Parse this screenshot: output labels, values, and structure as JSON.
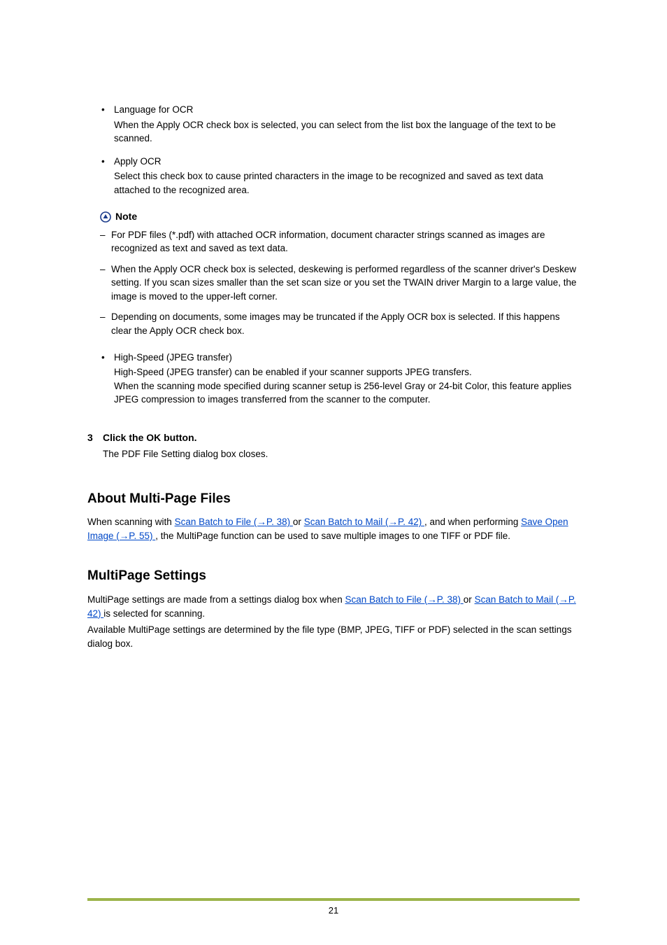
{
  "bullets": {
    "lang_ocr": {
      "label": "Language for OCR",
      "desc": "When the Apply OCR check box is selected, you can select from the list box the language of the text to be scanned."
    },
    "apply_ocr": {
      "label": "Apply OCR",
      "desc": "Select this check box to cause printed characters in the image to be recognized and saved as text data attached to the recognized area."
    },
    "high_speed": {
      "label": "High-Speed (JPEG transfer)",
      "desc1": "High-Speed (JPEG transfer) can be enabled if your scanner supports JPEG transfers.",
      "desc2": "When the scanning mode specified during scanner setup is 256-level Gray or 24-bit Color, this feature applies JPEG compression to images transferred from the scanner to the computer."
    }
  },
  "note": {
    "label": "Note",
    "item1": "For PDF files (*.pdf) with attached OCR information, document character strings scanned as images are recognized as text and saved as text data.",
    "item2": "When the Apply OCR check box is selected, deskewing is performed regardless of the scanner driver's Deskew setting. If you scan sizes smaller than the set scan size or you set the TWAIN driver Margin to a large value, the image is moved to the upper-left corner.",
    "item3": "Depending on documents, some images may be truncated if the Apply OCR box is selected. If this happens clear the Apply OCR check box."
  },
  "step3": {
    "num": "3",
    "title": "Click the OK button.",
    "desc": "The PDF File Setting dialog box closes."
  },
  "section_about": {
    "heading": "About Multi-Page Files",
    "p_pre": "When scanning with ",
    "link1": "Scan Batch to File  (→P. 38) ",
    "p_mid1": " or ",
    "link2": "Scan Batch to Mail  (→P. 42) ",
    "p_mid2": ", and when performing ",
    "link3": "Save Open Image  (→P. 55) ",
    "p_post": ", the MultiPage function can be used to save multiple images to one TIFF or PDF file."
  },
  "section_settings": {
    "heading": "MultiPage Settings",
    "p1_pre": "MultiPage settings are made from a settings dialog box when ",
    "link1": "Scan Batch to File  (→P. 38) ",
    "p1_mid": " or ",
    "link2": "Scan Batch to Mail  (→P. 42) ",
    "p1_post": " is selected for scanning.",
    "p2": "Available MultiPage settings are determined by the file type (BMP, JPEG, TIFF or PDF) selected in the scan settings dialog box."
  },
  "footer": {
    "page": "21"
  }
}
